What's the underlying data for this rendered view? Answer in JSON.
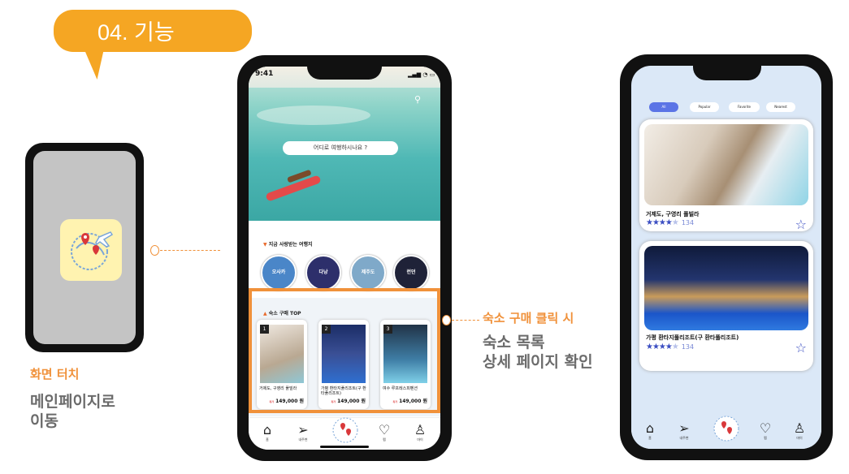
{
  "section_label": "04. 기능",
  "phone1": {
    "caption_action": "화면 터치",
    "caption_desc_line1": "메인페이지로",
    "caption_desc_line2": "이동"
  },
  "phone2": {
    "status_time": "9:41",
    "search_placeholder": "어디로 여행하시나요 ?",
    "popular_title": "지금 사랑받는 여행지",
    "destinations": [
      "오사카",
      "다낭",
      "제주도",
      "런던"
    ],
    "top_title": "숙소 구매 TOP",
    "top_items": [
      {
        "rank": "1",
        "name": "거제도, 구영리 풀빌라",
        "tag": "특가",
        "price": "149,000 원"
      },
      {
        "rank": "2",
        "name": "가평 환타지풀리조트(구 환타풀리조트)",
        "tag": "특가",
        "price": "149,000 원"
      },
      {
        "rank": "3",
        "name": "여수 루프레스피펜션",
        "tag": "특가",
        "price": "149,000 원"
      }
    ],
    "nav": [
      "홈",
      "내주변",
      "",
      "찜",
      "마이"
    ]
  },
  "annotation": {
    "action": "숙소 구매 클릭 시",
    "desc_line1": "숙소 목록",
    "desc_line2": "상세 페이지 확인"
  },
  "phone3": {
    "tabs": [
      "All",
      "Popular",
      "Favorite",
      "Nearest"
    ],
    "listings": [
      {
        "title": "거제도, 구영리 풀빌라",
        "rating": 4,
        "reviews": "134"
      },
      {
        "title": "가평 환타지풀리조트(구 환타풀리조트)",
        "rating": 4,
        "reviews": "134"
      }
    ],
    "nav": [
      "홈",
      "내주변",
      "",
      "찜",
      "마이"
    ]
  },
  "colors": {
    "accent": "#f0913a",
    "bubble": "#f5a623",
    "brand_blue": "#3b4ec2",
    "tab_active": "#5b74e6"
  }
}
